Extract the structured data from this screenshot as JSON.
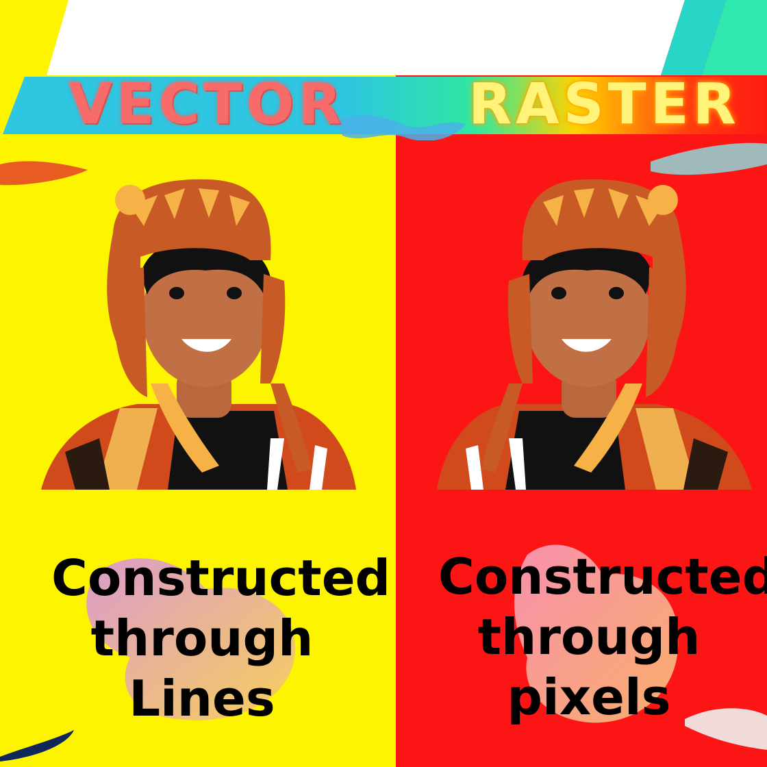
{
  "colors": {
    "left_bg": "#fdf400",
    "right_bg": "#fb1515",
    "vector_title": "#f76b6b",
    "raster_title": "#fff37a",
    "banner_cyan": "#2ec6e0",
    "banner_green": "#2fe8a0"
  },
  "left": {
    "title": "VECTOR",
    "caption": [
      "Constructed",
      "through",
      "Lines"
    ]
  },
  "right": {
    "title": "RASTER",
    "caption": [
      "Constructed",
      "through",
      "pixels"
    ]
  },
  "illustration": {
    "subject": "smiling child wearing a knitted chullo hat and striped poncho",
    "icon": "character-illustration-icon"
  }
}
